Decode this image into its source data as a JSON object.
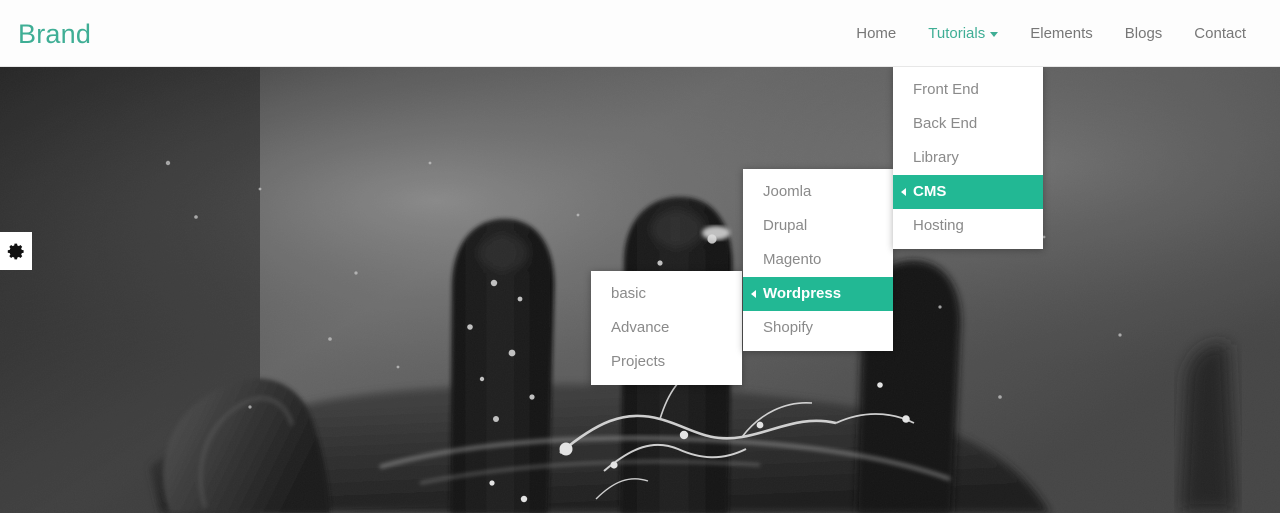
{
  "colors": {
    "brand_teal": "#3fae95",
    "highlight_teal": "#22b894",
    "nav_text": "#777777",
    "menu_text": "#8a8a8a",
    "header_bg": "#fdfdfd"
  },
  "header": {
    "brand": "Brand",
    "nav": [
      {
        "label": "Home",
        "active": false,
        "caret": false
      },
      {
        "label": "Tutorials",
        "active": true,
        "caret": true
      },
      {
        "label": "Elements",
        "active": false,
        "caret": false
      },
      {
        "label": "Blogs",
        "active": false,
        "caret": false
      },
      {
        "label": "Contact",
        "active": false,
        "caret": false
      }
    ]
  },
  "hero": {
    "alt": "grayscale photo of a hand with water splashing",
    "gear_icon": "gear-icon"
  },
  "dropdowns": {
    "level1": {
      "parent": "Tutorials",
      "items": [
        {
          "label": "Front End",
          "selected": false,
          "has_submenu": false
        },
        {
          "label": "Back End",
          "selected": false,
          "has_submenu": false
        },
        {
          "label": "Library",
          "selected": false,
          "has_submenu": false
        },
        {
          "label": "CMS",
          "selected": true,
          "has_submenu": true
        },
        {
          "label": "Hosting",
          "selected": false,
          "has_submenu": false
        }
      ]
    },
    "level2": {
      "parent": "CMS",
      "items": [
        {
          "label": "Joomla",
          "selected": false,
          "has_submenu": false
        },
        {
          "label": "Drupal",
          "selected": false,
          "has_submenu": false
        },
        {
          "label": "Magento",
          "selected": false,
          "has_submenu": false
        },
        {
          "label": "Wordpress",
          "selected": true,
          "has_submenu": true
        },
        {
          "label": "Shopify",
          "selected": false,
          "has_submenu": false
        }
      ]
    },
    "level3": {
      "parent": "Wordpress",
      "items": [
        {
          "label": "basic",
          "selected": false,
          "has_submenu": false
        },
        {
          "label": "Advance",
          "selected": false,
          "has_submenu": false
        },
        {
          "label": "Projects",
          "selected": false,
          "has_submenu": false
        }
      ]
    }
  }
}
